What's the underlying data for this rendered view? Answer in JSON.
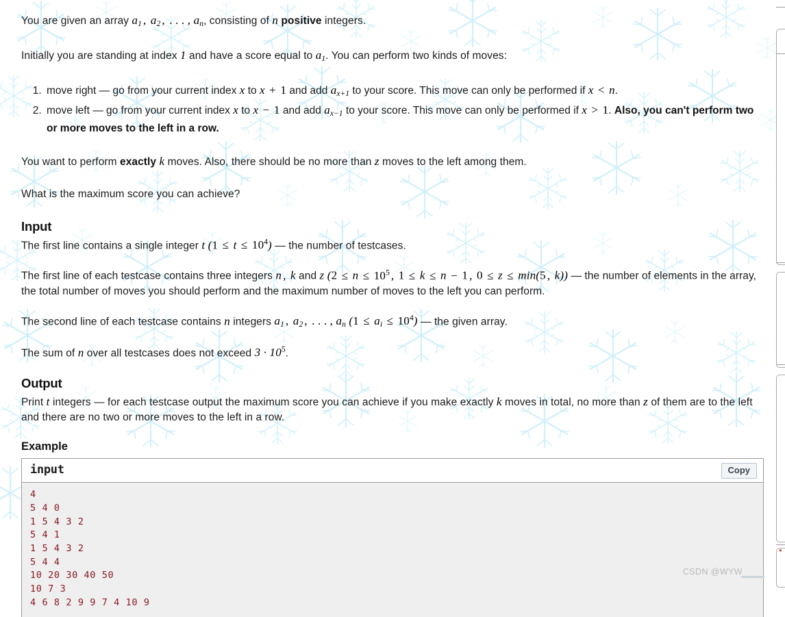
{
  "background": {
    "watermark_theme": "snowflakes",
    "snowflake_color": "#d7f3fb",
    "page_color": "#ffffff"
  },
  "statement": {
    "intro_1_pre": "You are given an array ",
    "intro_1_math": "a₁, a₂, … , aₙ",
    "intro_1_mid": ", consisting of ",
    "intro_1_n": "n",
    "intro_1_bold": "positive",
    "intro_1_post": " integers.",
    "intro_2_pre": "Initially you are standing at index ",
    "intro_2_one": "1",
    "intro_2_mid": " and have a score equal to ",
    "intro_2_a1": "a₁",
    "intro_2_post": ". You can perform two kinds of moves:",
    "move_right": {
      "lead": "move right — go from your current index ",
      "x1": "x",
      "to": " to ",
      "expr": "x + 1",
      "and_add": " and add ",
      "term": "aₓ₊₁",
      "tail": " to your score. This move can only be performed if ",
      "cond": "x < n",
      "period": "."
    },
    "move_left": {
      "lead": "move left — go from your current index ",
      "x1": "x",
      "to": " to ",
      "expr": "x − 1",
      "and_add": " and add ",
      "term": "aₓ₋₁",
      "tail": " to your score. This move can only be performed if ",
      "cond": "x > 1",
      "period": ". ",
      "bold_tail": "Also, you can't perform two or more moves to the left in a row."
    },
    "exactly_pre": "You want to perform ",
    "exactly_bold": "exactly",
    "exactly_k": "k",
    "exactly_mid": " moves. Also, there should be no more than ",
    "exactly_z": "z",
    "exactly_post": " moves to the left among them.",
    "question": "What is the maximum score you can achieve?"
  },
  "input_section": {
    "heading": "Input",
    "p1_pre": "The first line contains a single integer ",
    "p1_t": "t",
    "p1_range": "(1 ≤ t ≤ 10⁴)",
    "p1_post": " — the number of testcases.",
    "p2_pre": "The first line of each testcase contains three integers ",
    "p2_vars": "n, k",
    "p2_and": " and ",
    "p2_z": "z",
    "p2_range": "(2 ≤ n ≤ 10⁵, 1 ≤ k ≤ n − 1, 0 ≤ z ≤ min(5, k))",
    "p2_post": " — the number of elements in the array, the total number of moves you should perform and the maximum number of moves to the left you can perform.",
    "p3_pre": "The second line of each testcase contains ",
    "p3_n": "n",
    "p3_mid": " integers ",
    "p3_array": "a₁, a₂, … , aₙ",
    "p3_range": "(1 ≤ aᵢ ≤ 10⁴)",
    "p3_post": " — the given array.",
    "p4_pre": "The sum of ",
    "p4_n": "n",
    "p4_mid": " over all testcases does not exceed ",
    "p4_val": "3 · 10⁵",
    "p4_post": "."
  },
  "output_section": {
    "heading": "Output",
    "p1_pre": "Print ",
    "p1_t": "t",
    "p1_mid": " integers — for each testcase output the maximum score you can achieve if you make exactly ",
    "p1_k": "k",
    "p1_mid2": " moves in total, no more than ",
    "p1_z": "z",
    "p1_post": " of them are to the left and there are no two or more moves to the left in a row."
  },
  "example_section": {
    "heading": "Example",
    "sample": {
      "title": "input",
      "copy_label": "Copy",
      "lines": [
        "4",
        "5 4 0",
        "1 5 4 3 2",
        "5 4 1",
        "1 5 4 3 2",
        "5 4 4",
        "10 20 30 40 50",
        "10 7 3",
        "4 6 8 2 9 9 7 4 10 9"
      ]
    }
  },
  "watermark": {
    "text": "CSDN @WYW"
  }
}
